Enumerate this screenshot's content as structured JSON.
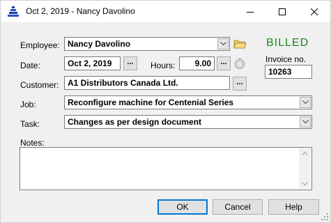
{
  "window": {
    "title": "Oct 2, 2019 - Nancy Davolino"
  },
  "status": {
    "label": "BILLED",
    "color": "#1a8a1a"
  },
  "employee": {
    "label": "Employee:",
    "value": "Nancy Davolino"
  },
  "date": {
    "label": "Date:",
    "value": "Oct 2, 2019"
  },
  "hours": {
    "label": "Hours:",
    "value": "9.00"
  },
  "invoice": {
    "label": "Invoice no.",
    "value": "10263"
  },
  "customer": {
    "label": "Customer:",
    "value": "A1 Distributors Canada Ltd."
  },
  "job": {
    "label": "Job:",
    "value": "Reconfigure machine for Centenial Series"
  },
  "task": {
    "label": "Task:",
    "value": "Changes as per design document"
  },
  "notes": {
    "label": "Notes:",
    "value": ""
  },
  "buttons": {
    "ok": "OK",
    "cancel": "Cancel",
    "help": "Help",
    "dots": "..."
  }
}
